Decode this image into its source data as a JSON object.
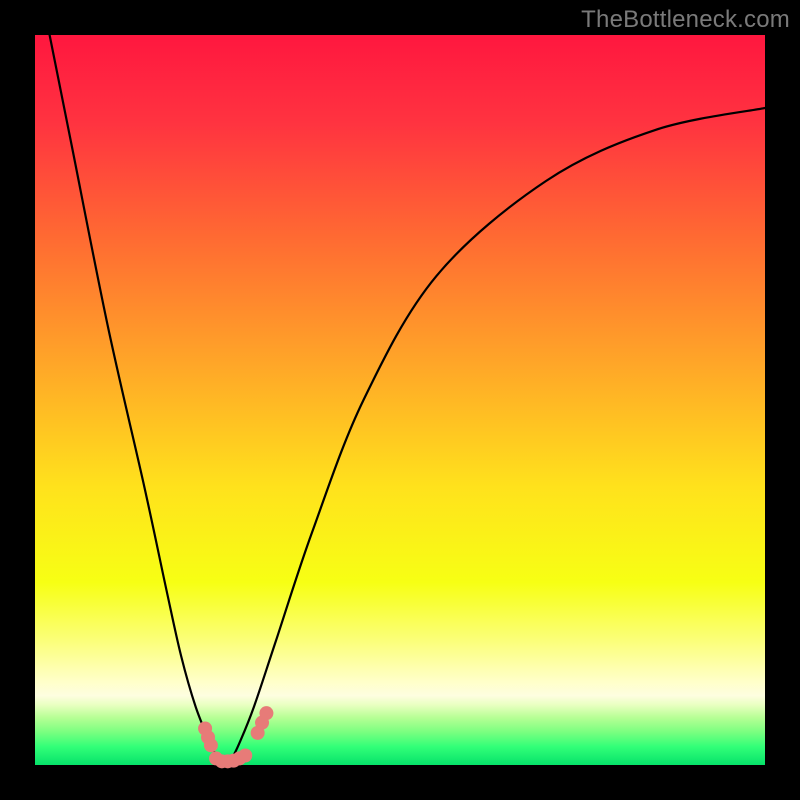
{
  "watermark": "TheBottleneck.com",
  "colors": {
    "black": "#000000",
    "curve": "#000000",
    "marker_fill": "#e77b78",
    "gradient_stops": [
      {
        "offset": 0.0,
        "color": "#ff173f"
      },
      {
        "offset": 0.12,
        "color": "#ff3340"
      },
      {
        "offset": 0.28,
        "color": "#ff6b32"
      },
      {
        "offset": 0.45,
        "color": "#ffa628"
      },
      {
        "offset": 0.62,
        "color": "#ffe21c"
      },
      {
        "offset": 0.75,
        "color": "#f7ff14"
      },
      {
        "offset": 0.83,
        "color": "#fbff7a"
      },
      {
        "offset": 0.885,
        "color": "#ffffc8"
      },
      {
        "offset": 0.905,
        "color": "#fefee0"
      },
      {
        "offset": 0.918,
        "color": "#e8ffc0"
      },
      {
        "offset": 0.935,
        "color": "#b7ff95"
      },
      {
        "offset": 0.955,
        "color": "#7aff80"
      },
      {
        "offset": 0.975,
        "color": "#32ff78"
      },
      {
        "offset": 1.0,
        "color": "#06e26a"
      }
    ]
  },
  "chart_data": {
    "type": "line",
    "title": "",
    "xlabel": "",
    "ylabel": "",
    "xlim": [
      0,
      100
    ],
    "ylim": [
      0,
      100
    ],
    "series": [
      {
        "name": "bottleneck-curve",
        "x": [
          2,
          5,
          10,
          15,
          18,
          20,
          22,
          24,
          25,
          26,
          27,
          28,
          30,
          33,
          38,
          45,
          55,
          70,
          85,
          100
        ],
        "values": [
          100,
          85,
          60,
          38,
          24,
          15,
          8,
          3,
          1,
          0,
          1,
          3,
          8,
          17,
          32,
          50,
          67,
          80,
          87,
          90
        ]
      }
    ],
    "markers": [
      {
        "name": "left-cluster-1",
        "x": 23.3,
        "y": 5.0
      },
      {
        "name": "left-cluster-2",
        "x": 23.7,
        "y": 3.8
      },
      {
        "name": "left-cluster-3",
        "x": 24.1,
        "y": 2.7
      },
      {
        "name": "bottom-1",
        "x": 24.8,
        "y": 0.9
      },
      {
        "name": "bottom-2",
        "x": 25.6,
        "y": 0.5
      },
      {
        "name": "bottom-3",
        "x": 26.4,
        "y": 0.5
      },
      {
        "name": "bottom-4",
        "x": 27.2,
        "y": 0.6
      },
      {
        "name": "bottom-5",
        "x": 28.0,
        "y": 0.9
      },
      {
        "name": "bottom-6",
        "x": 28.8,
        "y": 1.3
      },
      {
        "name": "right-cluster-1",
        "x": 30.5,
        "y": 4.4
      },
      {
        "name": "right-cluster-2",
        "x": 31.1,
        "y": 5.8
      },
      {
        "name": "right-cluster-3",
        "x": 31.7,
        "y": 7.1
      }
    ]
  }
}
